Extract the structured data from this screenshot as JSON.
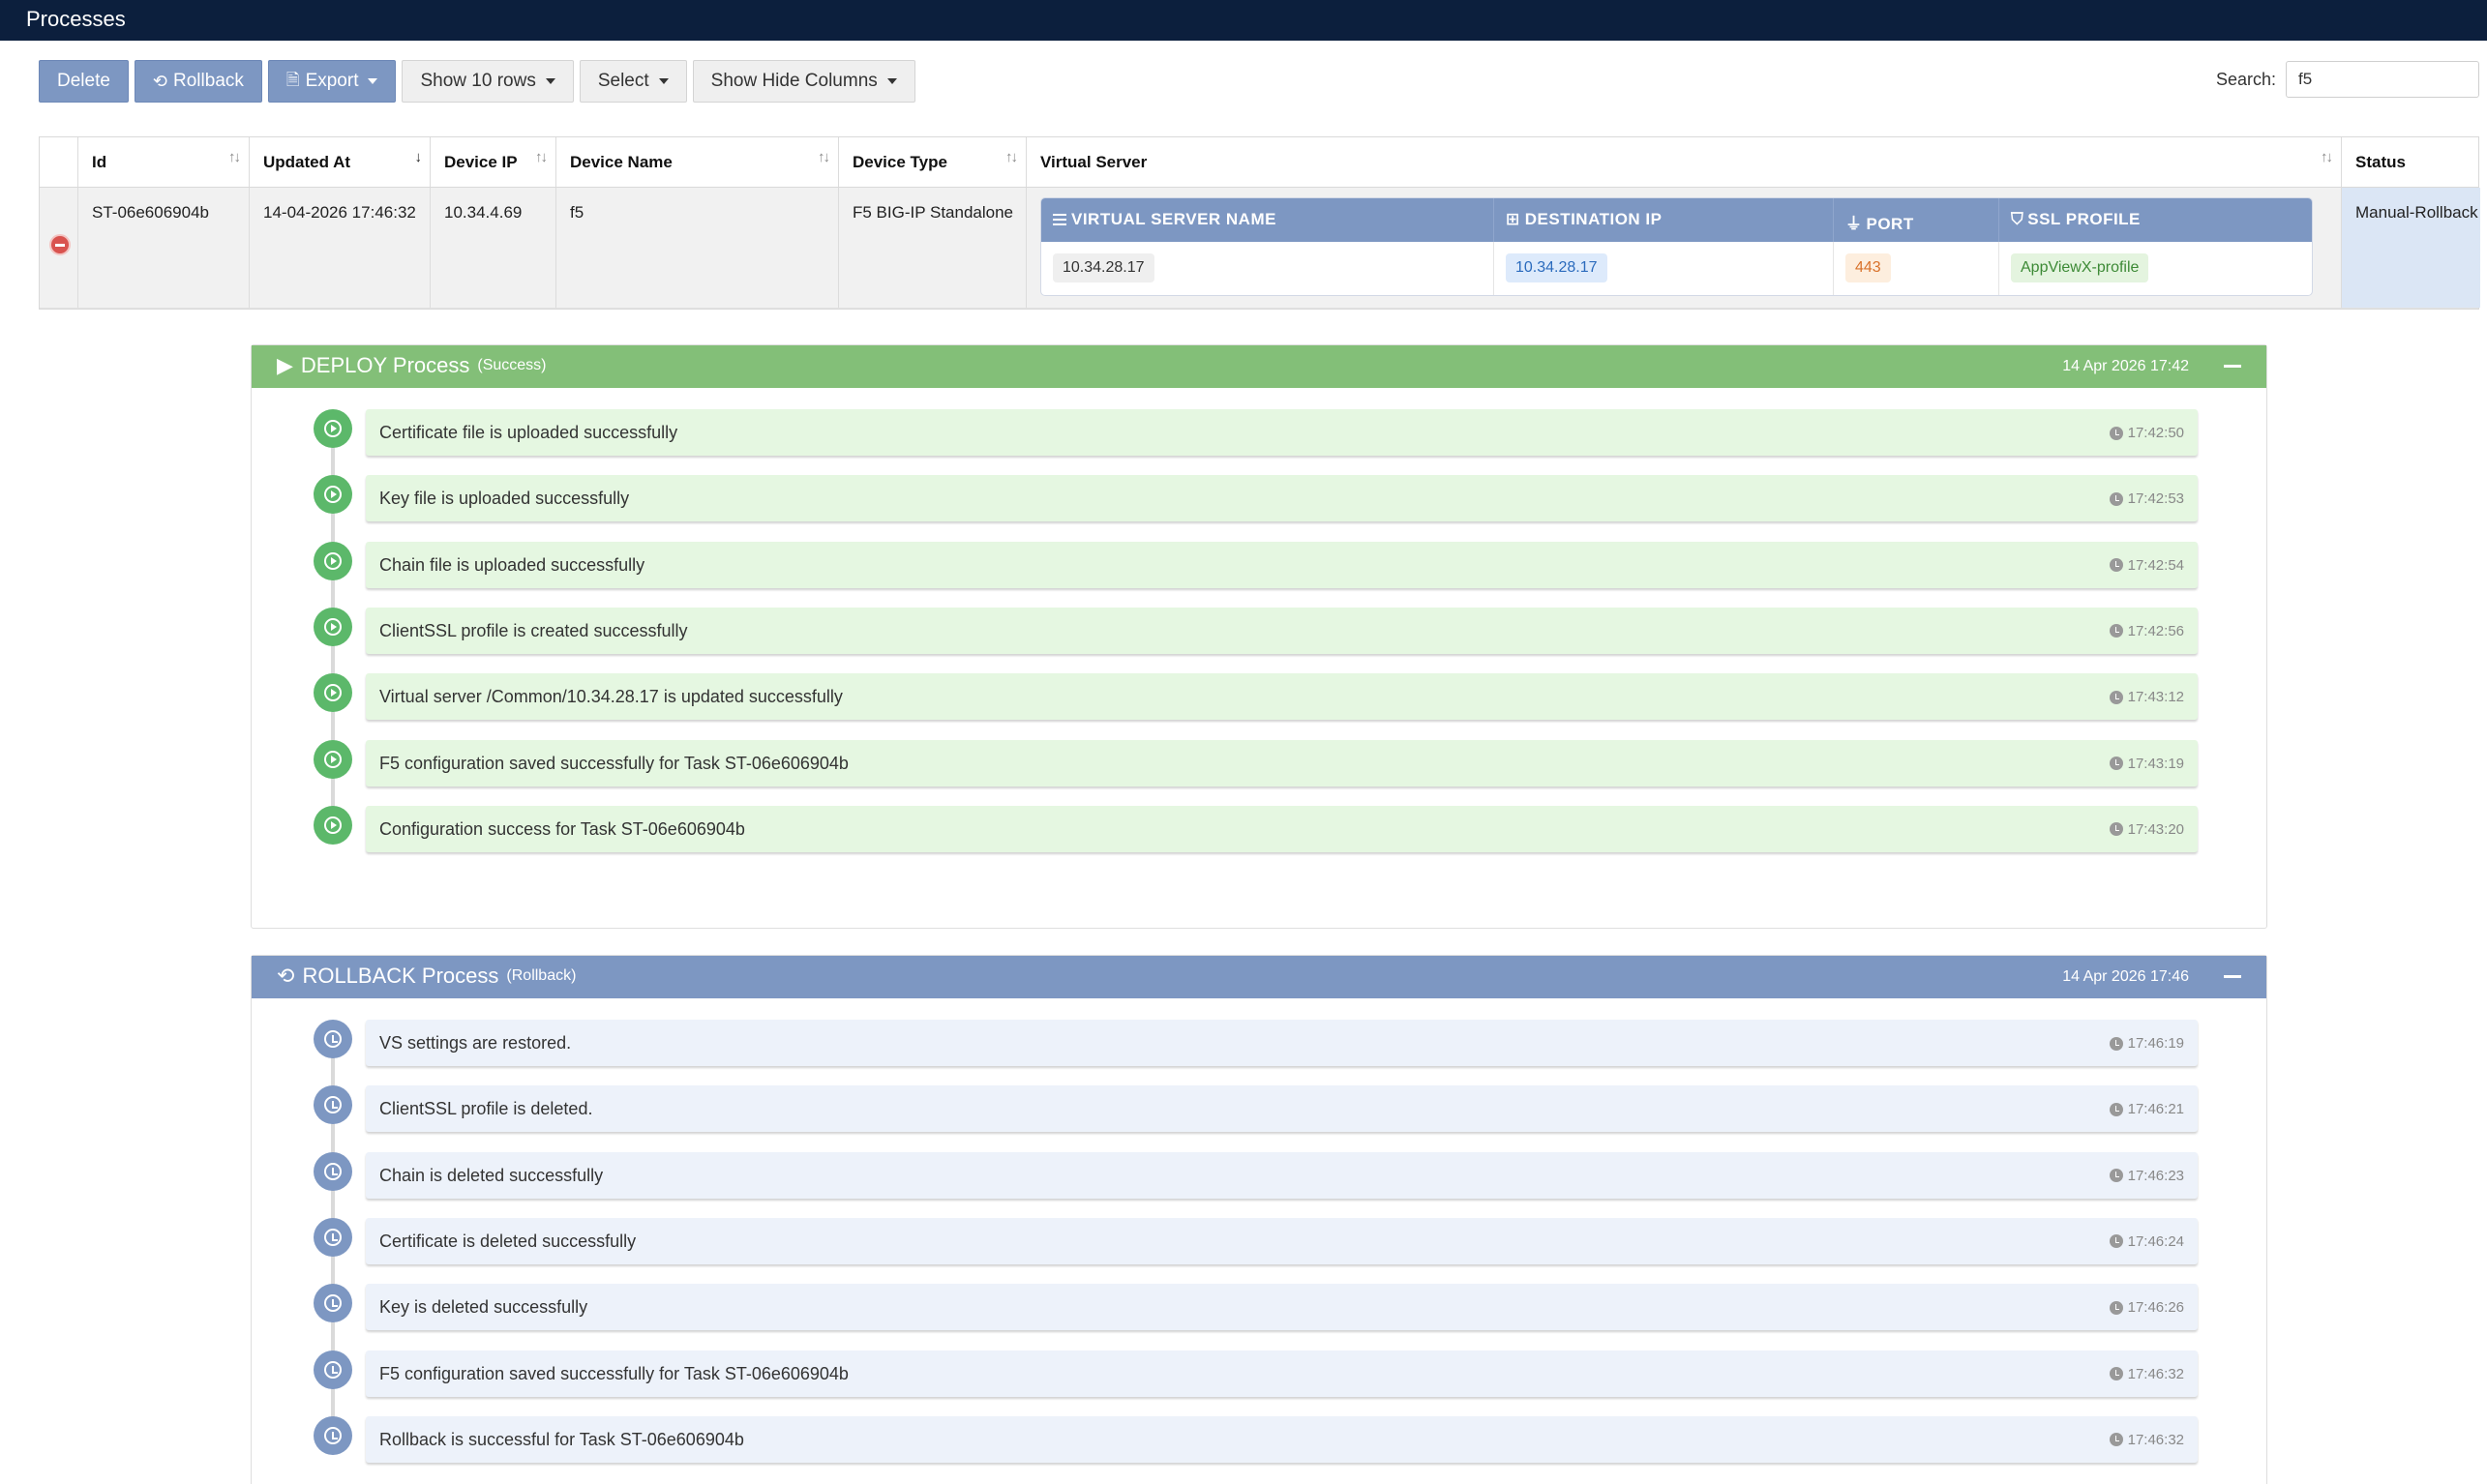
{
  "page": {
    "title": "Processes"
  },
  "toolbar": {
    "delete_label": "Delete",
    "rollback_label": "Rollback",
    "export_label": "Export",
    "show_rows_label": "Show 10 rows",
    "select_label": "Select",
    "show_hide_columns_label": "Show Hide Columns"
  },
  "search": {
    "label": "Search:",
    "value": "f5"
  },
  "table": {
    "columns": [
      "Id",
      "Updated At",
      "Device IP",
      "Device Name",
      "Device Type",
      "Virtual Server",
      "Status"
    ],
    "row": {
      "id": "ST-06e606904b",
      "updated_at": "14-04-2026 17:46:32",
      "device_ip": "10.34.4.69",
      "device_name": "f5",
      "device_type": "F5 BIG-IP Standalone",
      "status": "Manual-Rollback"
    },
    "virtual_server": {
      "headers": [
        "VIRTUAL SERVER NAME",
        "DESTINATION IP",
        "PORT",
        "SSL PROFILE"
      ],
      "name": "10.34.28.17",
      "destination_ip": "10.34.28.17",
      "port": "443",
      "ssl_profile": "AppViewX-profile"
    }
  },
  "deploy": {
    "title": "DEPLOY Process",
    "state": "(Success)",
    "date": "14 Apr 2026 17:42",
    "color": "#83bf78",
    "steps": [
      {
        "text": "Certificate file is uploaded successfully",
        "time": "17:42:50"
      },
      {
        "text": "Key file is uploaded successfully",
        "time": "17:42:53"
      },
      {
        "text": "Chain file is uploaded successfully",
        "time": "17:42:54"
      },
      {
        "text": "ClientSSL profile is created successfully",
        "time": "17:42:56"
      },
      {
        "text": "Virtual server /Common/10.34.28.17 is updated successfully",
        "time": "17:43:12"
      },
      {
        "text": "F5 configuration saved successfully for Task ST-06e606904b",
        "time": "17:43:19"
      },
      {
        "text": "Configuration success for Task ST-06e606904b",
        "time": "17:43:20"
      }
    ]
  },
  "rollback": {
    "title": "ROLLBACK Process",
    "state": "(Rollback)",
    "date": "14 Apr 2026 17:46",
    "color": "#7d97c2",
    "steps": [
      {
        "text": "VS settings are restored.",
        "time": "17:46:19"
      },
      {
        "text": "ClientSSL profile is deleted.",
        "time": "17:46:21"
      },
      {
        "text": "Chain is deleted successfully",
        "time": "17:46:23"
      },
      {
        "text": "Certificate is deleted successfully",
        "time": "17:46:24"
      },
      {
        "text": "Key is deleted successfully",
        "time": "17:46:26"
      },
      {
        "text": "F5 configuration saved successfully for Task ST-06e606904b",
        "time": "17:46:32"
      },
      {
        "text": "Rollback is successful for Task ST-06e606904b",
        "time": "17:46:32"
      }
    ]
  }
}
